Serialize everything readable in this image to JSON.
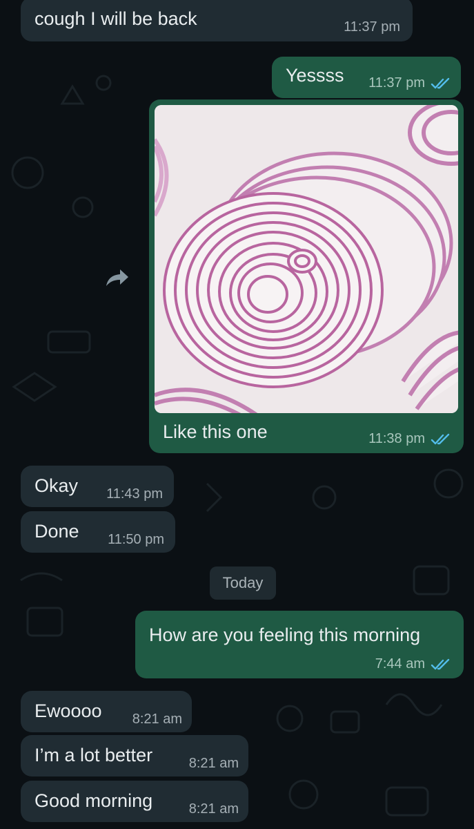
{
  "messages": [
    {
      "id": "m1",
      "direction": "incoming",
      "text": "cough I will be back",
      "time": "11:37 pm"
    },
    {
      "id": "m2",
      "direction": "outgoing",
      "text": "Yessss",
      "time": "11:37 pm",
      "read": true
    },
    {
      "id": "m3",
      "direction": "outgoing",
      "type": "image",
      "image_subject": "red onion slices",
      "caption": "Like this one",
      "time": "11:38 pm",
      "read": true
    },
    {
      "id": "m4",
      "direction": "incoming",
      "text": "Okay",
      "time": "11:43 pm"
    },
    {
      "id": "m5",
      "direction": "incoming",
      "text": "Done",
      "time": "11:50 pm"
    },
    {
      "id": "m6",
      "direction": "outgoing",
      "text": "How are you feeling this morning",
      "time": "7:44 am",
      "read": true
    },
    {
      "id": "m7",
      "direction": "incoming",
      "text": "Ewoooo",
      "time": "8:21 am"
    },
    {
      "id": "m8",
      "direction": "incoming",
      "text": "I’m a lot better",
      "time": "8:21 am"
    },
    {
      "id": "m9",
      "direction": "incoming",
      "text": "Good morning",
      "time": "8:21 am"
    }
  ],
  "date_separator": "Today",
  "icons": {
    "forward": "forward-icon",
    "read_receipt": "double-check-icon"
  },
  "colors": {
    "background": "#0b1014",
    "incoming_bubble": "#202c33",
    "outgoing_bubble": "#1f5a44",
    "read_tick": "#53bdeb"
  }
}
